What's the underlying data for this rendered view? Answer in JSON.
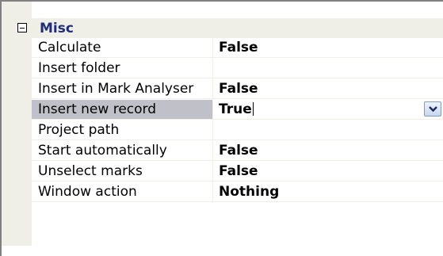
{
  "property_grid": {
    "category": {
      "label": "Misc",
      "expanded": true
    },
    "properties": [
      {
        "name": "Calculate",
        "value": "False"
      },
      {
        "name": "Insert folder",
        "value": ""
      },
      {
        "name": "Insert in Mark Analyser",
        "value": "False"
      },
      {
        "name": "Insert new record",
        "value": "True",
        "selected": true
      },
      {
        "name": "Project path",
        "value": ""
      },
      {
        "name": "Start automatically",
        "value": "False"
      },
      {
        "name": "Unselect marks",
        "value": "False"
      },
      {
        "name": "Window action",
        "value": "Nothing"
      }
    ],
    "icons": {
      "expander": "collapse-minus-icon",
      "dropdown": "chevron-down-icon"
    },
    "colors": {
      "category_text": "#1f2e7a",
      "gutter": "#f0efe7",
      "selected_row": "#c0c0c8"
    }
  }
}
